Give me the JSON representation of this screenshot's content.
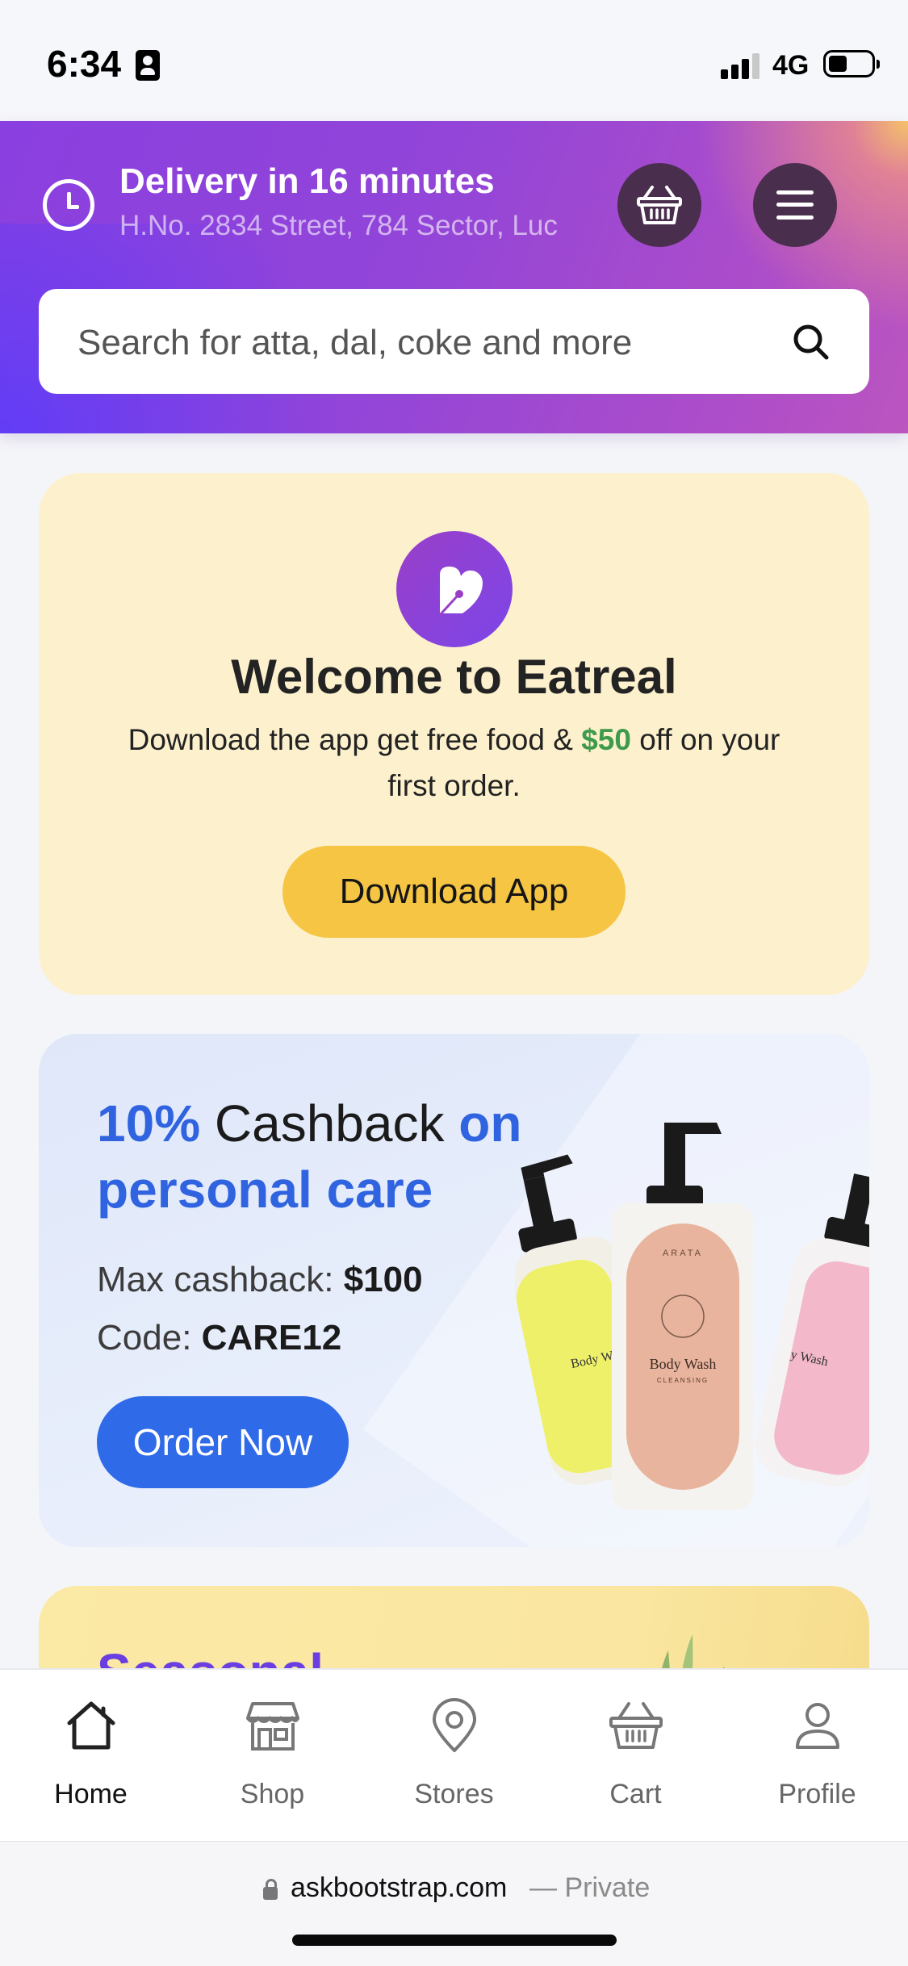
{
  "status_bar": {
    "time": "6:34",
    "network": "4G"
  },
  "header": {
    "delivery_title": "Delivery in 16 minutes",
    "delivery_address": "H.No. 2834 Street, 784 Sector, Luc",
    "search_placeholder": "Search for atta, dal, coke and more"
  },
  "welcome": {
    "title": "Welcome to Eatreal",
    "desc_before": "Download the app get free food & ",
    "desc_amount": "$50",
    "desc_after": " off on your first order.",
    "button_label": "Download App"
  },
  "cashback": {
    "percent": "10%",
    "word": " Cashback ",
    "on": "on",
    "category": "personal care",
    "max_label": "Max cashback: ",
    "max_value": "$100",
    "code_label": "Code: ",
    "code_value": "CARE12",
    "button_label": "Order Now",
    "product_label": "Body Wash",
    "product_brand": "ARATA",
    "product_variant": "CLEANSING"
  },
  "next_card": {
    "title_partial": "Seasonal"
  },
  "bottom_nav": {
    "items": [
      {
        "label": "Home",
        "icon": "home-icon",
        "active": true
      },
      {
        "label": "Shop",
        "icon": "shop-icon",
        "active": false
      },
      {
        "label": "Stores",
        "icon": "location-pin-icon",
        "active": false
      },
      {
        "label": "Cart",
        "icon": "basket-icon",
        "active": false
      },
      {
        "label": "Profile",
        "icon": "user-icon",
        "active": false
      }
    ]
  },
  "browser": {
    "url": "askbootstrap.com",
    "mode": "— Private"
  },
  "colors": {
    "header_purple": "#8a3fe0",
    "welcome_bg": "#fdf1cd",
    "download_yellow": "#f5c543",
    "cashback_bg": "#dfe7f9",
    "accent_blue": "#2f63df",
    "order_blue": "#2f6ae8",
    "amount_green": "#3f9a4c"
  }
}
